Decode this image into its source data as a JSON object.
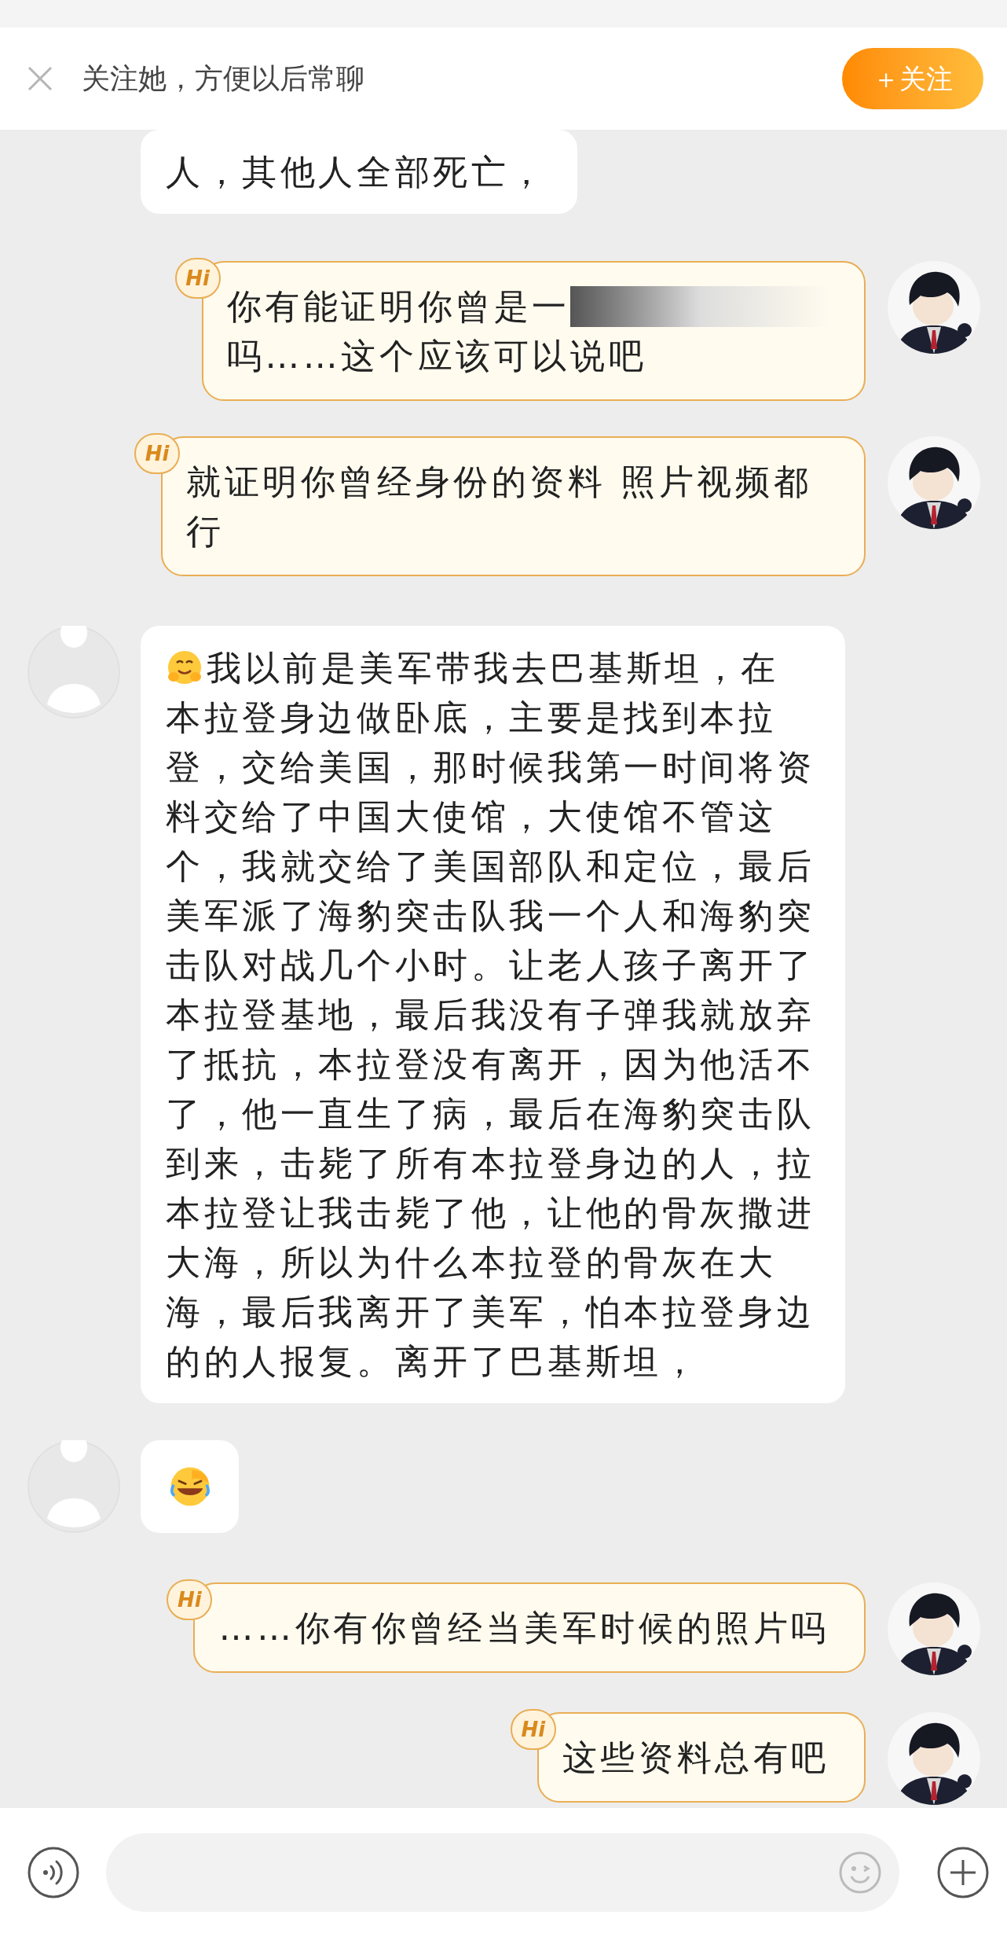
{
  "banner": {
    "text": "关注她，方便以后常聊",
    "button": "＋关注"
  },
  "messages": [
    {
      "kind": "incoming",
      "avatar": false,
      "text": "人，其他人全部死亡，"
    },
    {
      "kind": "outgoing",
      "badge": "Hi",
      "text": "你有能证明你曾是一",
      "redacted": true,
      "text_2": "吗……这个应该可以说吧"
    },
    {
      "kind": "outgoing",
      "badge": "Hi",
      "text": "就证明你曾经身份的资料 照片视频都行"
    },
    {
      "kind": "incoming",
      "avatar": true,
      "leading_emoji": true,
      "text": "我以前是美军带我去巴基斯坦，在本拉登身边做卧底，主要是找到本拉登，交给美国，那时候我第一时间将资料交给了中国大使馆，大使馆不管这个，我就交给了美国部队和定位，最后美军派了海豹突击队我一个人和海豹突击队对战几个小时。让老人孩子离开了本拉登基地，最后我没有子弹我就放弃了抵抗，本拉登没有离开，因为他活不了，他一直生了病，最后在海豹突击队到来，击毙了所有本拉登身边的人，拉本拉登让我击毙了他，让他的骨灰撒进大海，所以为什么本拉登的骨灰在大海，最后我离开了美军，怕本拉登身边的的人报复。离开了巴基斯坦，"
    },
    {
      "kind": "incoming_emoji",
      "avatar": true
    },
    {
      "kind": "outgoing",
      "badge": "Hi",
      "text": "……你有你曾经当美军时候的照片吗"
    },
    {
      "kind": "outgoing",
      "badge": "Hi",
      "text": "这些资料总有吧"
    }
  ]
}
